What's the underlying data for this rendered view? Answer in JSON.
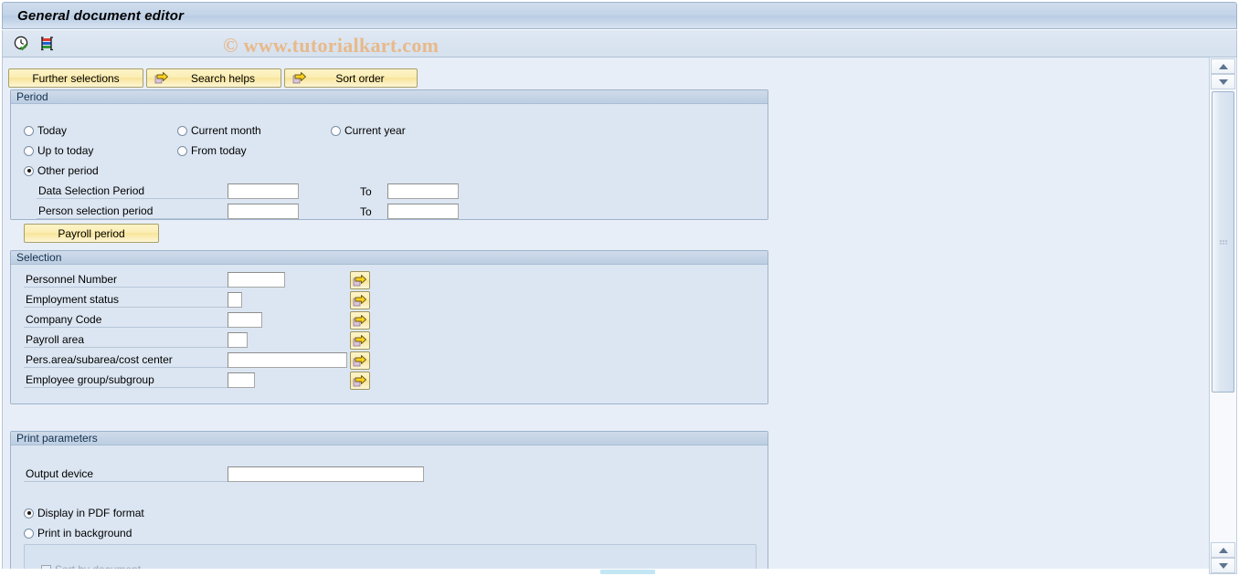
{
  "window": {
    "title": "General document editor"
  },
  "toolbar": {
    "icons": [
      {
        "name": "execute-clock-icon",
        "tooltip": "Execute"
      },
      {
        "name": "variant-list-icon",
        "tooltip": "Get Variant"
      }
    ],
    "watermark": "© www.tutorialkart.com"
  },
  "buttons": {
    "further_selections": "Further selections",
    "search_helps": "Search helps",
    "sort_order": "Sort order"
  },
  "period": {
    "header": "Period",
    "radios": [
      {
        "label": "Today",
        "selected": false
      },
      {
        "label": "Current month",
        "selected": false
      },
      {
        "label": "Current year",
        "selected": false
      },
      {
        "label": "Up to today",
        "selected": false
      },
      {
        "label": "From today",
        "selected": false
      },
      {
        "label": "Other period",
        "selected": true
      }
    ],
    "rows": [
      {
        "label": "Data Selection Period",
        "value": "",
        "to_label": "To",
        "to_value": ""
      },
      {
        "label": "Person selection period",
        "value": "",
        "to_label": "To",
        "to_value": ""
      }
    ],
    "payroll_period_button": "Payroll period"
  },
  "selection": {
    "header": "Selection",
    "rows": [
      {
        "label": "Personnel Number",
        "value": ""
      },
      {
        "label": "Employment status",
        "value": ""
      },
      {
        "label": "Company Code",
        "value": ""
      },
      {
        "label": "Payroll area",
        "value": ""
      },
      {
        "label": "Pers.area/subarea/cost center",
        "value": ""
      },
      {
        "label": "Employee group/subgroup",
        "value": ""
      }
    ],
    "multi_select_icon": "arrow-right-multiselect-icon"
  },
  "print_parameters": {
    "header": "Print parameters",
    "output_device_label": "Output device",
    "output_device_value": "",
    "radios": [
      {
        "label": "Display in PDF format",
        "selected": true
      },
      {
        "label": "Print in background",
        "selected": false
      }
    ],
    "sub_options": [
      {
        "label": "Sort by document",
        "checked": false,
        "disabled": true
      }
    ]
  },
  "scrollbars": {
    "vertical": {
      "up_icon": "scroll-up-icon",
      "down_icon": "scroll-down-icon"
    },
    "horizontal": {
      "name": "horizontal-scrollbar"
    }
  },
  "colors": {
    "content_bg": "#e8eef7",
    "group_bg": "#dce6f2",
    "group_header": "#c4d3e5",
    "button_yellow": "#fbeeb4",
    "title_bar": "#c3d4e8",
    "watermark": "#e8b98a"
  }
}
